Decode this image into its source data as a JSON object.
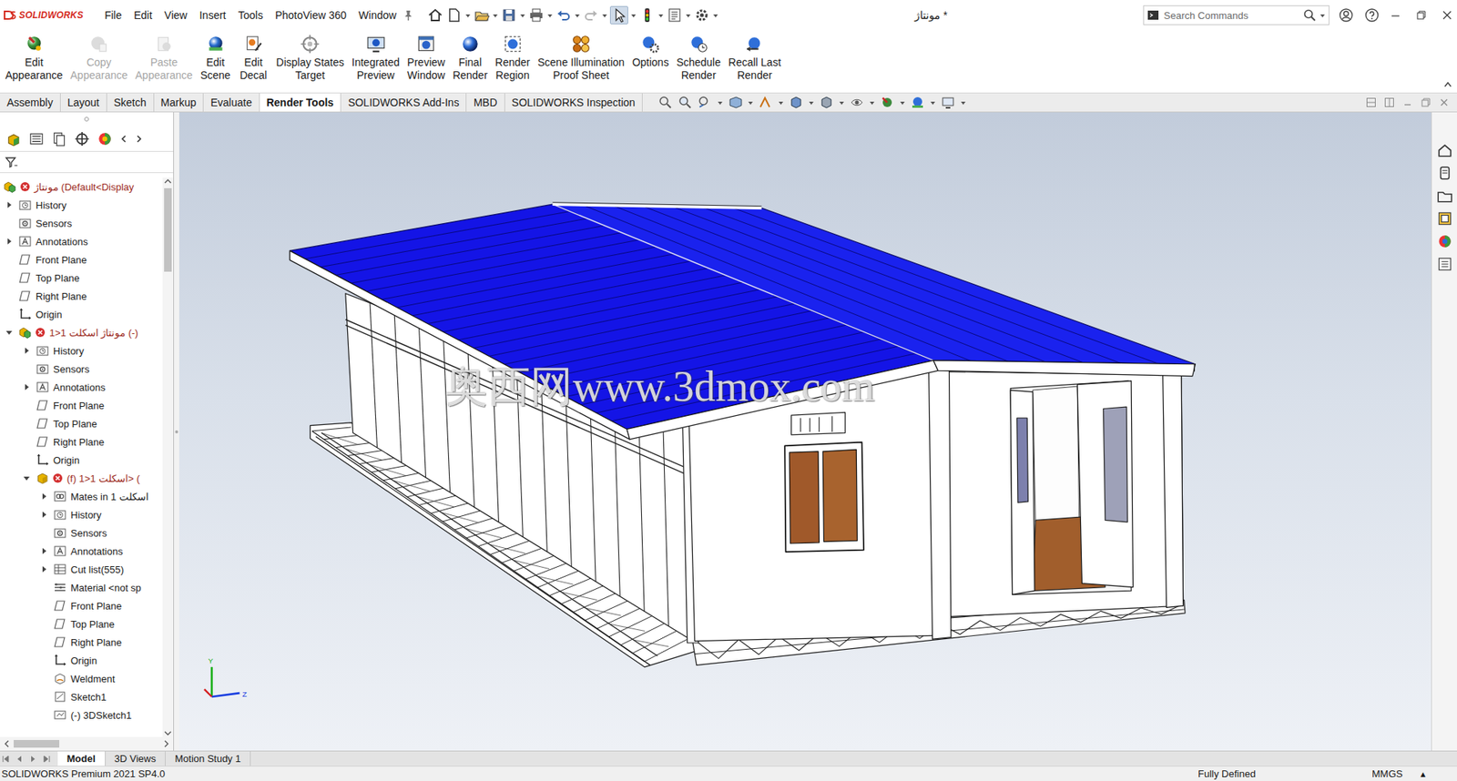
{
  "app": {
    "logo": "SOLIDWORKS",
    "title": "مونتاژ *"
  },
  "menu": [
    "File",
    "Edit",
    "View",
    "Insert",
    "Tools",
    "PhotoView 360",
    "Window"
  ],
  "search": {
    "placeholder": "Search Commands"
  },
  "ribbon": [
    {
      "lines": [
        "Edit",
        "Appearance"
      ],
      "disabled": false
    },
    {
      "lines": [
        "Copy",
        "Appearance"
      ],
      "disabled": true
    },
    {
      "lines": [
        "Paste",
        "Appearance"
      ],
      "disabled": true
    },
    {
      "lines": [
        "Edit",
        "Scene"
      ],
      "disabled": false
    },
    {
      "lines": [
        "Edit",
        "Decal"
      ],
      "disabled": false
    },
    {
      "lines": [
        "Display States",
        "Target"
      ],
      "disabled": false
    },
    {
      "lines": [
        "Integrated",
        "Preview"
      ],
      "disabled": false
    },
    {
      "lines": [
        "Preview",
        "Window"
      ],
      "disabled": false
    },
    {
      "lines": [
        "Final",
        "Render"
      ],
      "disabled": false
    },
    {
      "lines": [
        "Render",
        "Region"
      ],
      "disabled": false
    },
    {
      "lines": [
        "Scene Illumination",
        "Proof Sheet"
      ],
      "disabled": false
    },
    {
      "lines": [
        "Options"
      ],
      "disabled": false
    },
    {
      "lines": [
        "Schedule",
        "Render"
      ],
      "disabled": false
    },
    {
      "lines": [
        "Recall Last",
        "Render"
      ],
      "disabled": false
    }
  ],
  "tabs": [
    {
      "label": "Assembly",
      "selected": false
    },
    {
      "label": "Layout",
      "selected": false
    },
    {
      "label": "Sketch",
      "selected": false
    },
    {
      "label": "Markup",
      "selected": false
    },
    {
      "label": "Evaluate",
      "selected": false
    },
    {
      "label": "Render Tools",
      "selected": true
    },
    {
      "label": "SOLIDWORKS Add-Ins",
      "selected": false
    },
    {
      "label": "MBD",
      "selected": false
    },
    {
      "label": "SOLIDWORKS Inspection",
      "selected": false
    }
  ],
  "tree": [
    {
      "label": "مونتاژ  (Default<Display",
      "depth": 0,
      "expandable": false,
      "expanded": false,
      "kind": "assembly",
      "error": true
    },
    {
      "label": "History",
      "depth": 1,
      "expandable": true,
      "expanded": false,
      "kind": "history",
      "error": false
    },
    {
      "label": "Sensors",
      "depth": 1,
      "expandable": false,
      "expanded": false,
      "kind": "sensor",
      "error": false
    },
    {
      "label": "Annotations",
      "depth": 1,
      "expandable": true,
      "expanded": false,
      "kind": "annotation",
      "error": false
    },
    {
      "label": "Front Plane",
      "depth": 1,
      "expandable": false,
      "expanded": false,
      "kind": "plane",
      "error": false
    },
    {
      "label": "Top Plane",
      "depth": 1,
      "expandable": false,
      "expanded": false,
      "kind": "plane",
      "error": false
    },
    {
      "label": "Right Plane",
      "depth": 1,
      "expandable": false,
      "expanded": false,
      "kind": "plane",
      "error": false
    },
    {
      "label": "Origin",
      "depth": 1,
      "expandable": false,
      "expanded": false,
      "kind": "origin",
      "error": false
    },
    {
      "label": "مونتاژ اسکلت 1<1 (-)",
      "depth": 1,
      "expandable": true,
      "expanded": true,
      "kind": "assembly",
      "error": true
    },
    {
      "label": "History",
      "depth": 2,
      "expandable": true,
      "expanded": false,
      "kind": "history",
      "error": false
    },
    {
      "label": "Sensors",
      "depth": 2,
      "expandable": false,
      "expanded": false,
      "kind": "sensor",
      "error": false
    },
    {
      "label": "Annotations",
      "depth": 2,
      "expandable": true,
      "expanded": false,
      "kind": "annotation",
      "error": false
    },
    {
      "label": "Front Plane",
      "depth": 2,
      "expandable": false,
      "expanded": false,
      "kind": "plane",
      "error": false
    },
    {
      "label": "Top Plane",
      "depth": 2,
      "expandable": false,
      "expanded": false,
      "kind": "plane",
      "error": false
    },
    {
      "label": "Right Plane",
      "depth": 2,
      "expandable": false,
      "expanded": false,
      "kind": "plane",
      "error": false
    },
    {
      "label": "Origin",
      "depth": 2,
      "expandable": false,
      "expanded": false,
      "kind": "origin",
      "error": false
    },
    {
      "label": "(f) اسکلت 1<1> (",
      "depth": 2,
      "expandable": true,
      "expanded": true,
      "kind": "part",
      "error": true
    },
    {
      "label": "Mates in اسکلت 1",
      "depth": 3,
      "expandable": true,
      "expanded": false,
      "kind": "mates",
      "error": false
    },
    {
      "label": "History",
      "depth": 3,
      "expandable": true,
      "expanded": false,
      "kind": "history",
      "error": false
    },
    {
      "label": "Sensors",
      "depth": 3,
      "expandable": false,
      "expanded": false,
      "kind": "sensor",
      "error": false
    },
    {
      "label": "Annotations",
      "depth": 3,
      "expandable": true,
      "expanded": false,
      "kind": "annotation",
      "error": false
    },
    {
      "label": "Cut list(555)",
      "depth": 3,
      "expandable": true,
      "expanded": false,
      "kind": "cutlist",
      "error": false
    },
    {
      "label": "Material <not sp",
      "depth": 3,
      "expandable": false,
      "expanded": false,
      "kind": "material",
      "error": false
    },
    {
      "label": "Front Plane",
      "depth": 3,
      "expandable": false,
      "expanded": false,
      "kind": "plane",
      "error": false
    },
    {
      "label": "Top Plane",
      "depth": 3,
      "expandable": false,
      "expanded": false,
      "kind": "plane",
      "error": false
    },
    {
      "label": "Right Plane",
      "depth": 3,
      "expandable": false,
      "expanded": false,
      "kind": "plane",
      "error": false
    },
    {
      "label": "Origin",
      "depth": 3,
      "expandable": false,
      "expanded": false,
      "kind": "origin",
      "error": false
    },
    {
      "label": "Weldment",
      "depth": 3,
      "expandable": false,
      "expanded": false,
      "kind": "weldment",
      "error": false
    },
    {
      "label": "Sketch1",
      "depth": 3,
      "expandable": false,
      "expanded": false,
      "kind": "sketch",
      "error": false
    },
    {
      "label": "(-) 3DSketch1",
      "depth": 3,
      "expandable": false,
      "expanded": false,
      "kind": "sketch3d",
      "error": false
    }
  ],
  "viewport": {
    "watermark": "奥西网www.3dmox.com",
    "triad": [
      "Y",
      "Z"
    ]
  },
  "bottom_tabs": [
    {
      "label": "Model",
      "selected": true
    },
    {
      "label": "3D Views",
      "selected": false
    },
    {
      "label": "Motion Study 1",
      "selected": false
    }
  ],
  "status_bar": {
    "product": "SOLIDWORKS Premium 2021 SP4.0",
    "state": "Fully Defined",
    "units": "MMGS",
    "menu_arrow": "▴"
  }
}
